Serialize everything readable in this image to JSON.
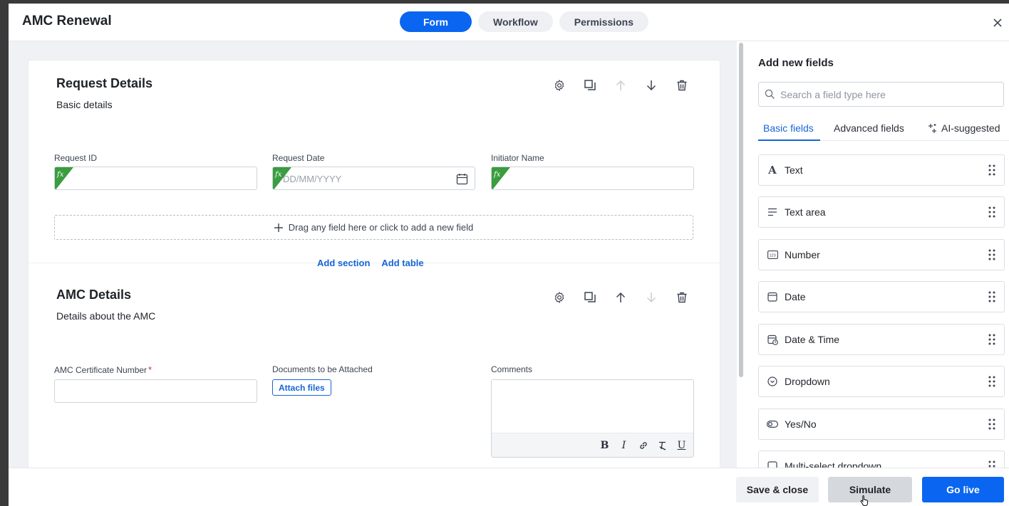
{
  "header": {
    "title": "AMC Renewal",
    "tabs": [
      {
        "label": "Form",
        "active": true
      },
      {
        "label": "Workflow",
        "active": false
      },
      {
        "label": "Permissions",
        "active": false
      }
    ]
  },
  "sections": [
    {
      "title": "Request Details",
      "subtitle": "Basic details",
      "fields": [
        {
          "label": "Request ID",
          "formula": true
        },
        {
          "label": "Request Date",
          "placeholder": "DD/MM/YYYY",
          "formula": true
        },
        {
          "label": "Initiator Name",
          "formula": true
        }
      ],
      "dropzone": "Drag any field here or click to add a new field"
    },
    {
      "title": "AMC Details",
      "subtitle": "Details about the AMC",
      "fields": [
        {
          "label": "AMC Certificate Number",
          "required_mark": "*"
        },
        {
          "label": "Documents to be Attached",
          "button": "Attach files"
        },
        {
          "label": "Comments"
        }
      ]
    }
  ],
  "add_links": {
    "section": "Add section",
    "table": "Add table"
  },
  "panel": {
    "title": "Add new fields",
    "search_placeholder": "Search a field type here",
    "tabs": [
      {
        "label": "Basic fields",
        "active": true
      },
      {
        "label": "Advanced fields",
        "active": false
      },
      {
        "label": "AI-suggested",
        "active": false
      }
    ],
    "field_types": [
      {
        "label": "Text",
        "icon": "text-type-icon"
      },
      {
        "label": "Text area",
        "icon": "text-area-icon"
      },
      {
        "label": "Number",
        "icon": "number-icon"
      },
      {
        "label": "Date",
        "icon": "calendar-icon"
      },
      {
        "label": "Date & Time",
        "icon": "calendar-clock-icon"
      },
      {
        "label": "Dropdown",
        "icon": "dropdown-icon"
      },
      {
        "label": "Yes/No",
        "icon": "toggle-icon"
      },
      {
        "label": "Multi-select dropdown",
        "icon": "multiselect-icon"
      }
    ]
  },
  "footer": {
    "save_close": "Save & close",
    "simulate": "Simulate",
    "go_live": "Go live"
  },
  "colors": {
    "primary": "#0a66f0",
    "link": "#1565d8",
    "formula_badge": "#3a9d3f"
  }
}
